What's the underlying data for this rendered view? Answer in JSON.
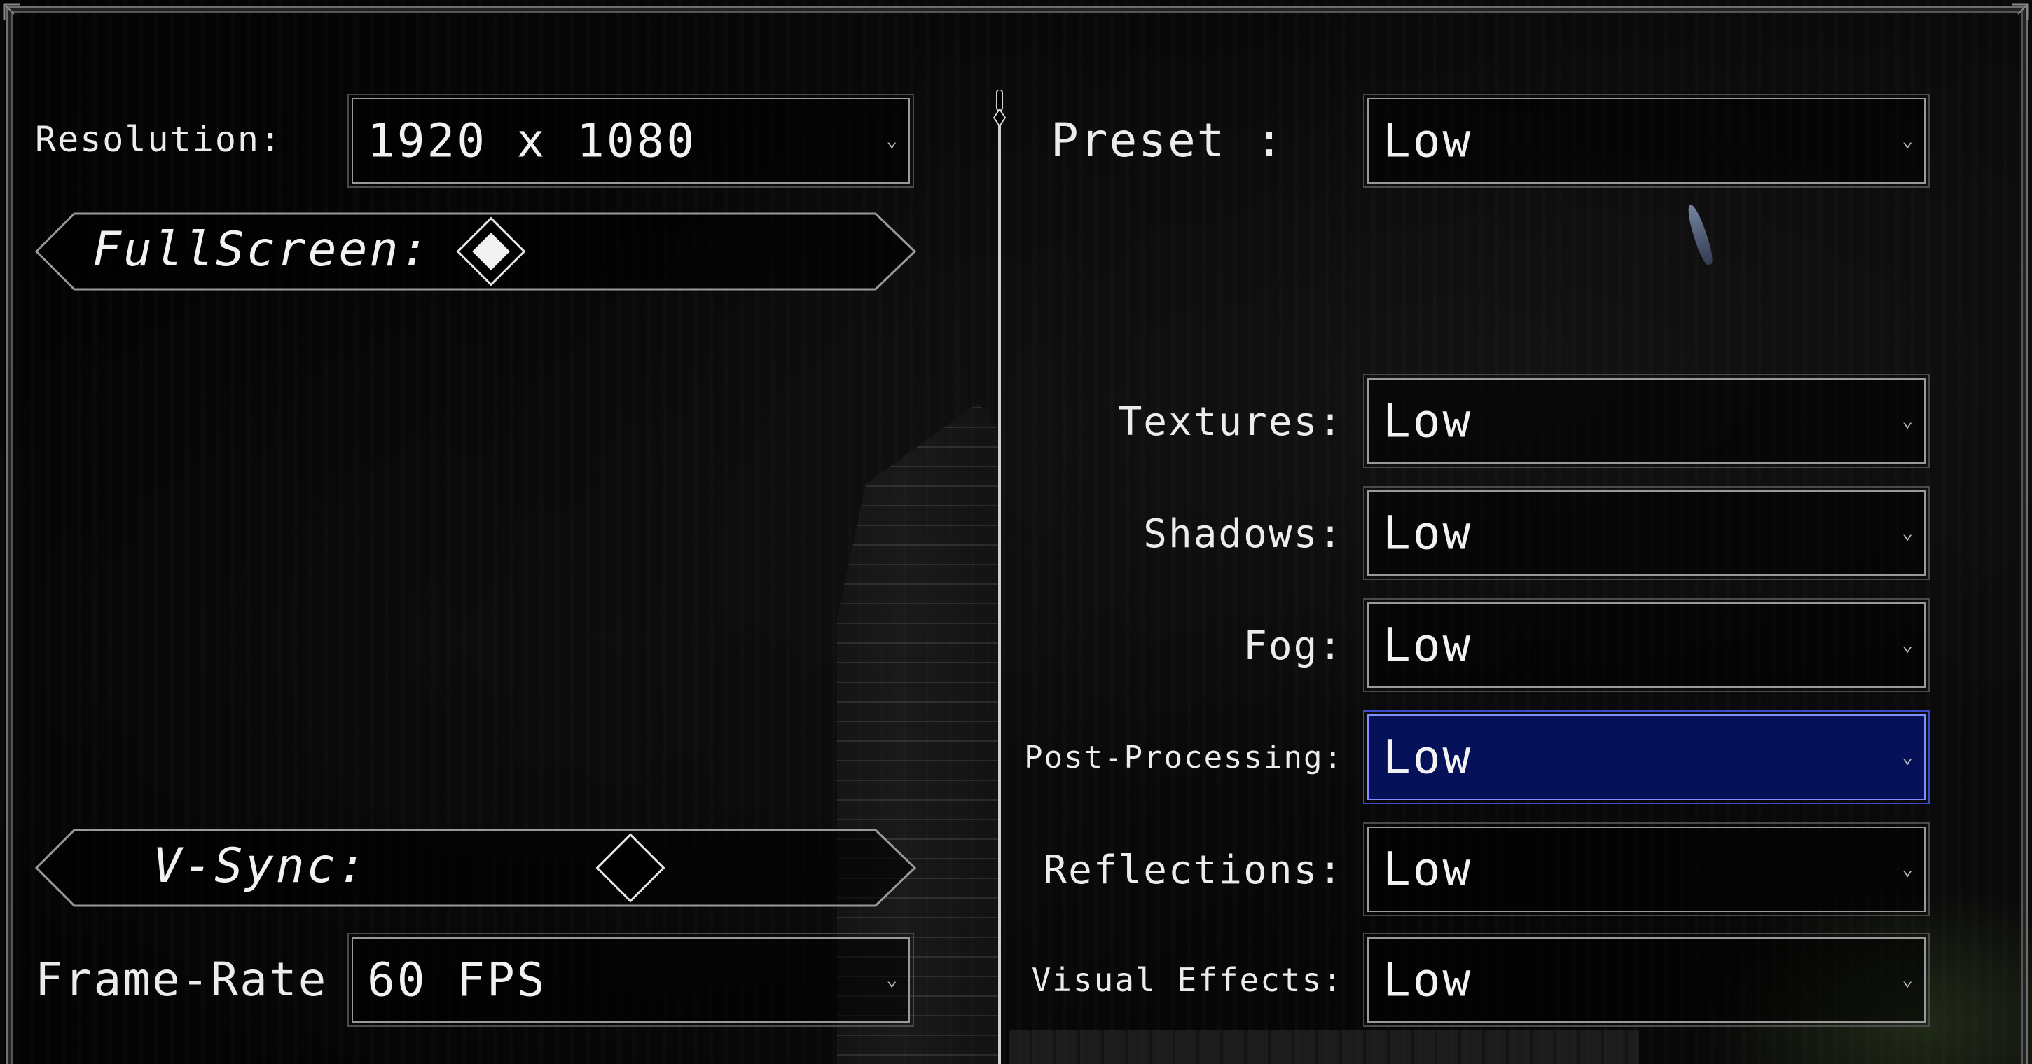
{
  "left_panel": {
    "resolution": {
      "label": "Resolution:",
      "value": "1920 x 1080"
    },
    "fullscreen": {
      "label": "FullScreen:",
      "enabled": true
    },
    "vsync": {
      "label": "V-Sync:",
      "enabled": false
    },
    "frame_rate": {
      "label": "Frame-Rate",
      "value": "60 FPS"
    }
  },
  "right_panel": {
    "preset": {
      "label": "Preset :",
      "value": "Low"
    },
    "settings": [
      {
        "label": "Textures:",
        "value": "Low",
        "highlighted": false
      },
      {
        "label": "Shadows:",
        "value": "Low",
        "highlighted": false
      },
      {
        "label": "Fog:",
        "value": "Low",
        "highlighted": false
      },
      {
        "label": "Post-Processing:",
        "value": "Low",
        "highlighted": true
      },
      {
        "label": "Reflections:",
        "value": "Low",
        "highlighted": false
      },
      {
        "label": "Visual Effects:",
        "value": "Low",
        "highlighted": false
      }
    ]
  },
  "icons": {
    "dropdown": "chevron-down-icon",
    "toggle": "diamond-checkbox-icon"
  },
  "colors": {
    "highlight_bg": "#07115a",
    "highlight_border": "#7f8fff",
    "frame": "#6e6e6e",
    "text": "#ececec"
  }
}
